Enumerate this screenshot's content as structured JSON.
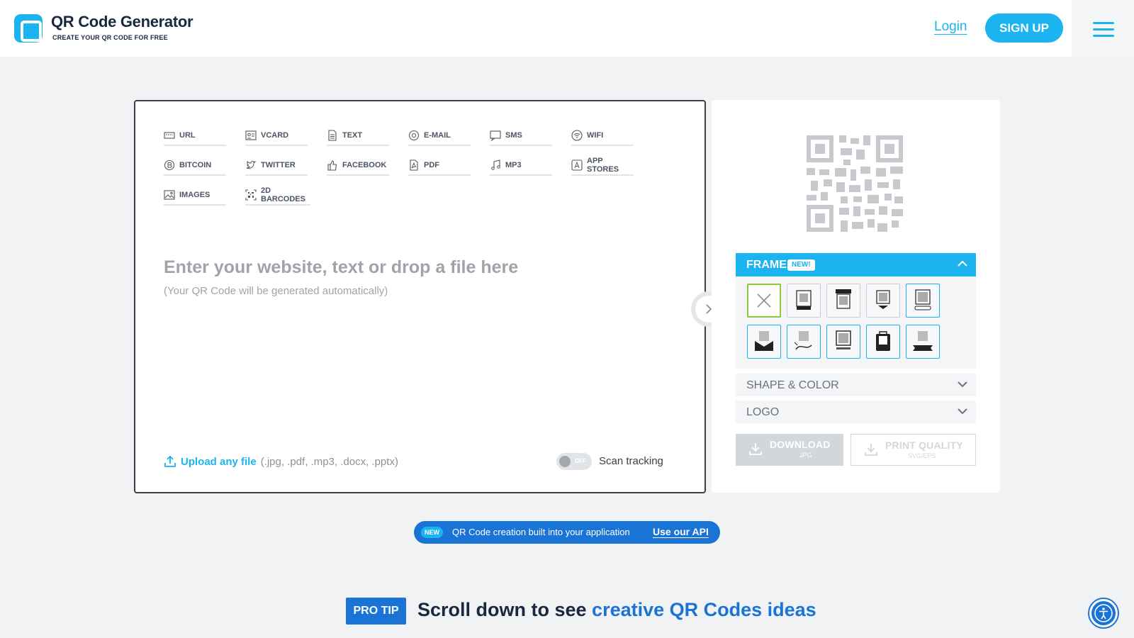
{
  "header": {
    "brand_title": "QR Code Generator",
    "brand_subtitle": "CREATE YOUR QR CODE FOR FREE",
    "login_label": "Login",
    "signup_label": "SIGN UP",
    "menu_icon": "hamburger-icon"
  },
  "qr_types": [
    {
      "label": "URL",
      "icon": "url-icon"
    },
    {
      "label": "VCARD",
      "icon": "vcard-icon"
    },
    {
      "label": "TEXT",
      "icon": "text-icon"
    },
    {
      "label": "E-MAIL",
      "icon": "email-icon"
    },
    {
      "label": "SMS",
      "icon": "sms-icon"
    },
    {
      "label": "WIFI",
      "icon": "wifi-icon"
    },
    {
      "label": "BITCOIN",
      "icon": "bitcoin-icon"
    },
    {
      "label": "TWITTER",
      "icon": "twitter-icon"
    },
    {
      "label": "FACEBOOK",
      "icon": "facebook-icon"
    },
    {
      "label": "PDF",
      "icon": "pdf-icon"
    },
    {
      "label": "MP3",
      "icon": "mp3-icon"
    },
    {
      "label": "APP STORES",
      "icon": "app-stores-icon"
    },
    {
      "label": "IMAGES",
      "icon": "images-icon"
    },
    {
      "label": "2D BARCODES",
      "icon": "barcode-icon"
    }
  ],
  "input": {
    "placeholder_title": "Enter your website, text or drop a file here",
    "placeholder_sub": "(Your QR Code will be generated automatically)"
  },
  "upload": {
    "link_label": "Upload any file",
    "extensions": "(.jpg, .pdf, .mp3, .docx, .pptx)"
  },
  "scan_tracking": {
    "toggle_state": "OFF",
    "label": "Scan tracking"
  },
  "customize": {
    "frame_label": "FRAME",
    "frame_badge": "NEW!",
    "shape_color_label": "SHAPE & COLOR",
    "logo_label": "LOGO",
    "download_label": "DOWNLOAD",
    "download_format": "JPG",
    "print_label": "PRINT QUALITY",
    "print_format": "SVG/EPS"
  },
  "api_banner": {
    "badge": "NEW",
    "text": "QR Code creation built into your application",
    "link": "Use our API"
  },
  "pro_tip": {
    "badge": "PRO TIP",
    "text": "Scroll down to see ",
    "highlight": "creative QR Codes ideas"
  },
  "colors": {
    "accent": "#1cb4f0",
    "brand_dark": "#1a2740",
    "api_blue": "#1a74d6",
    "selected_frame": "#8ec63f"
  }
}
